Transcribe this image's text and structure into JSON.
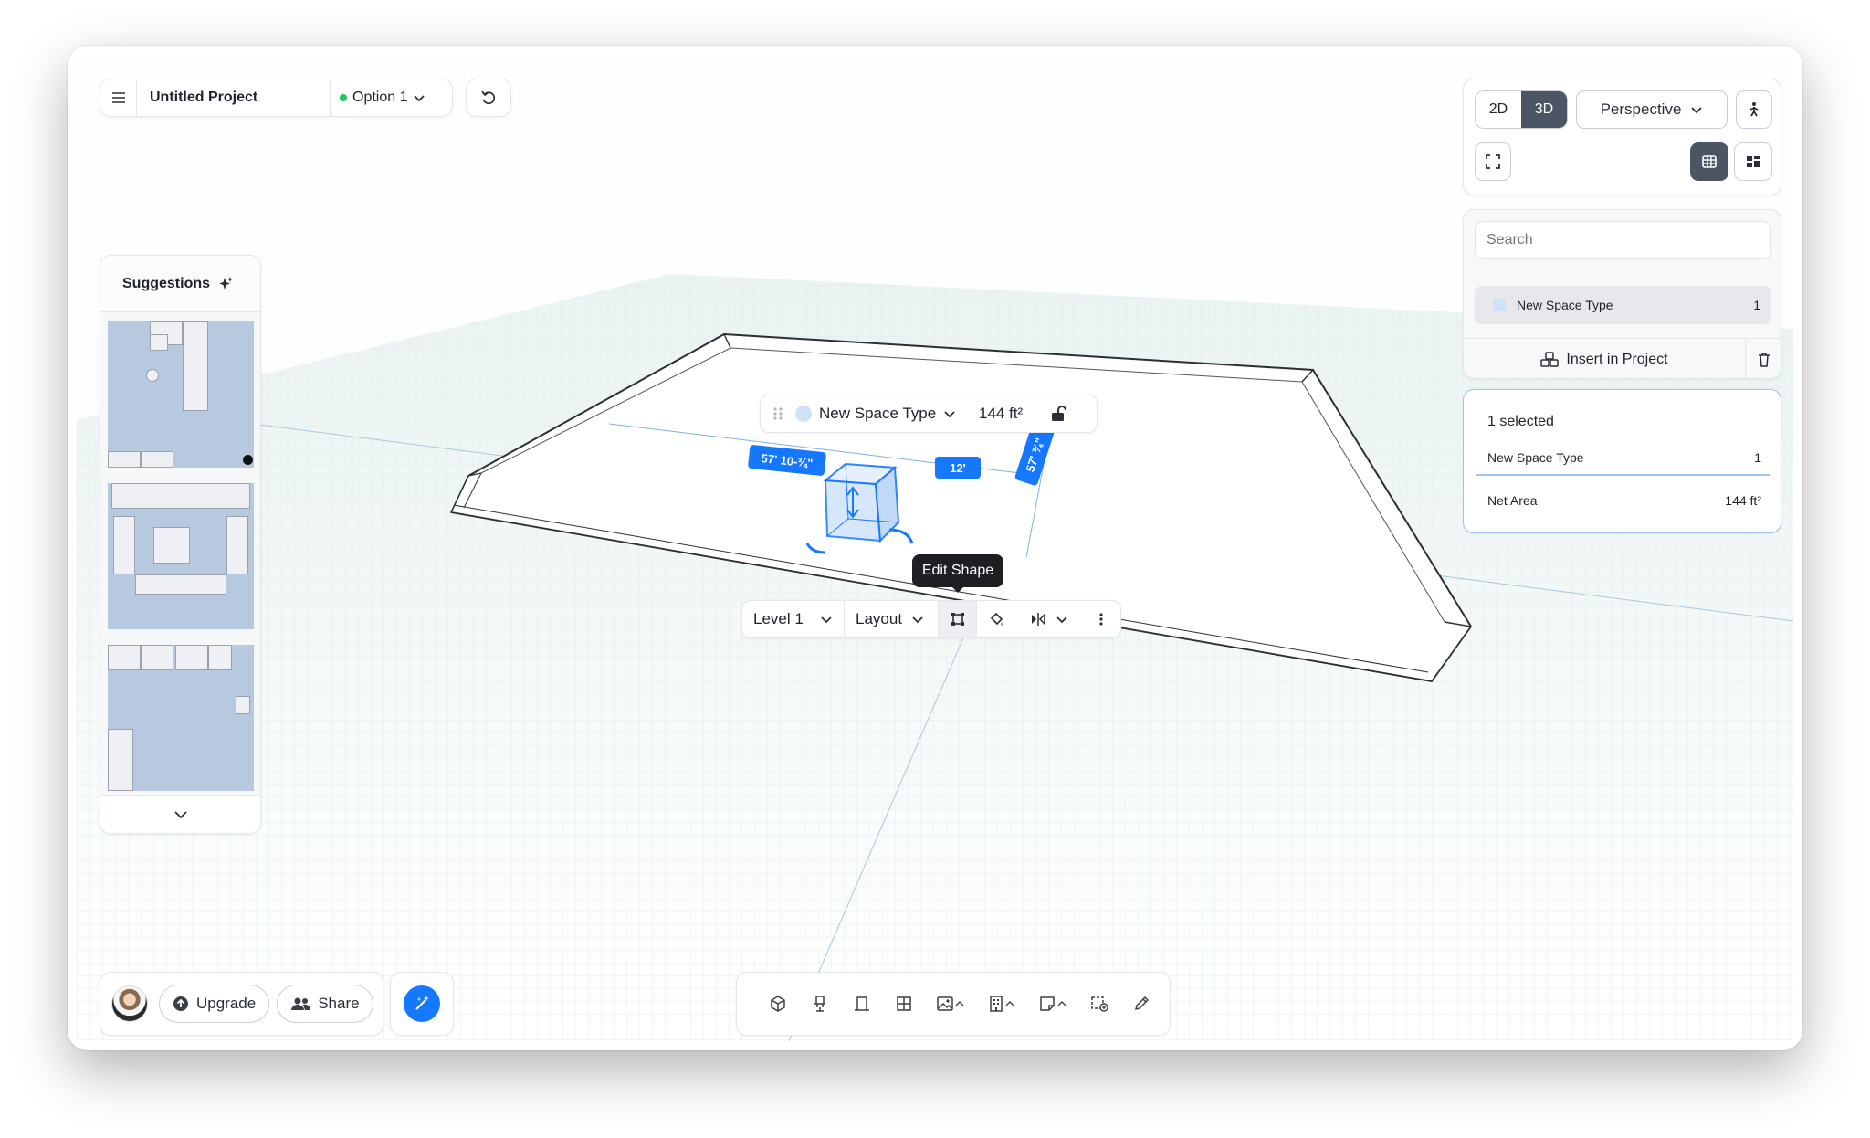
{
  "header": {
    "project_title": "Untitled Project",
    "option_label": "Option 1"
  },
  "suggestions": {
    "title": "Suggestions"
  },
  "view_controls": {
    "mode_2d": "2D",
    "mode_3d": "3D",
    "active_mode": "3D",
    "camera": "Perspective"
  },
  "space_list": {
    "search_placeholder": "Search",
    "items": [
      {
        "name": "New Space Type",
        "count": "1"
      }
    ],
    "insert_label": "Insert in Project"
  },
  "selection": {
    "summary": "1 selected",
    "rows": [
      {
        "label": "New Space Type",
        "value": "1"
      },
      {
        "label": "Net Area",
        "value": "144 ft²"
      }
    ]
  },
  "canvas": {
    "space_toolbar": {
      "type_name": "New Space Type",
      "area": "144 ft²"
    },
    "dimensions": {
      "length": "57' 10-¾\"",
      "width": "57' ¾\"",
      "box": "12'"
    },
    "context_bar": {
      "level": "Level 1",
      "layout": "Layout"
    },
    "tooltip": "Edit Shape"
  },
  "bottom": {
    "upgrade_label": "Upgrade",
    "share_label": "Share"
  },
  "colors": {
    "accent": "#1677ff",
    "selection_border": "#9cc3ee",
    "status_green": "#22c55e"
  }
}
